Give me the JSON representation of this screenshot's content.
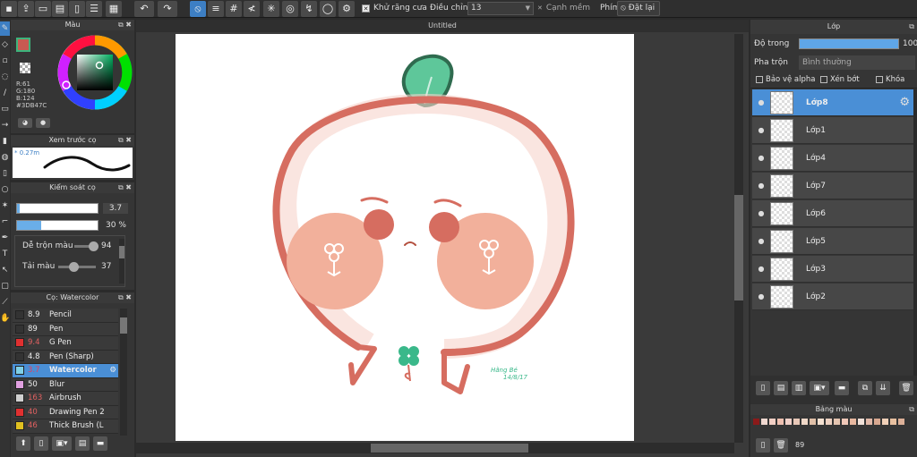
{
  "toolbar": {
    "antialias_label": "Khử răng cưa",
    "adjust_label": "Điều chỉnh",
    "adjust_value": "13",
    "edge_label": "Cạnh mềm",
    "key_label": "Phím",
    "reset_label": "Đặt lại"
  },
  "document": {
    "tab_title": "Untitled"
  },
  "color_panel": {
    "title": "Màu",
    "r": "R:61",
    "g": "G:180",
    "b": "B:124",
    "hex": "#3DB47C",
    "primary_color": "#c85a52",
    "hue_indicator_color": "#3DB47C"
  },
  "preview_panel": {
    "title": "Xem trước cọ",
    "size_text": "* 0.27m"
  },
  "brush_control": {
    "title": "Kiểm soát cọ",
    "size_value": "3.7",
    "opacity_value": "30",
    "opacity_unit": "%",
    "blend_label": "Dễ trộn màu",
    "blend_value": "94",
    "reuse_label": "Tải màu",
    "reuse_value": "37"
  },
  "brush_list": {
    "title": "Cọ: Watercolor",
    "items": [
      {
        "size": "8.9",
        "name": "Pencil",
        "color": "#333333"
      },
      {
        "size": "89",
        "name": "Pen",
        "color": "#333333"
      },
      {
        "size": "9.4",
        "name": "G Pen",
        "color": "#e03030"
      },
      {
        "size": "4.8",
        "name": "Pen (Sharp)",
        "color": "#333333"
      },
      {
        "size": "3.7",
        "name": "Watercolor",
        "color": "#7fd0e8"
      },
      {
        "size": "50",
        "name": "Blur",
        "color": "#e0a0e0"
      },
      {
        "size": "163",
        "name": "Airbrush",
        "color": "#d0d0d0"
      },
      {
        "size": "40",
        "name": "Drawing Pen 2",
        "color": "#e03030"
      },
      {
        "size": "46",
        "name": "Thick Brush (L",
        "color": "#e0c020"
      }
    ]
  },
  "layer_panel": {
    "title": "Lớp",
    "opacity_label": "Độ trong",
    "opacity_value": "100",
    "blend_label": "Pha trộn",
    "blend_value": "Bình thường",
    "protect_alpha": "Bảo vệ alpha",
    "clipping": "Xén bớt",
    "lock": "Khóa",
    "layers": [
      "Lớp8",
      "Lớp1",
      "Lớp4",
      "Lớp7",
      "Lớp6",
      "Lớp5",
      "Lớp3",
      "Lớp2"
    ]
  },
  "palette_panel": {
    "title": "Bảng màu",
    "count": "89",
    "colors": [
      "#8b1a1a",
      "#f0d8d0",
      "#f2cfc4",
      "#eec0b0",
      "#f0d0c8",
      "#e8c8b8",
      "#f0d8c8",
      "#e0c0a8",
      "#f4e0d0",
      "#ecd0c0",
      "#e4c4b0",
      "#f0c8b8",
      "#e8b8a0",
      "#f0e0d8",
      "#e0b8a8",
      "#d8a890",
      "#f0d0b8",
      "#e8c0a0",
      "#dcb098"
    ]
  },
  "artwork": {
    "signature": "Hằng Bé",
    "signature_date": "14/8/17"
  }
}
